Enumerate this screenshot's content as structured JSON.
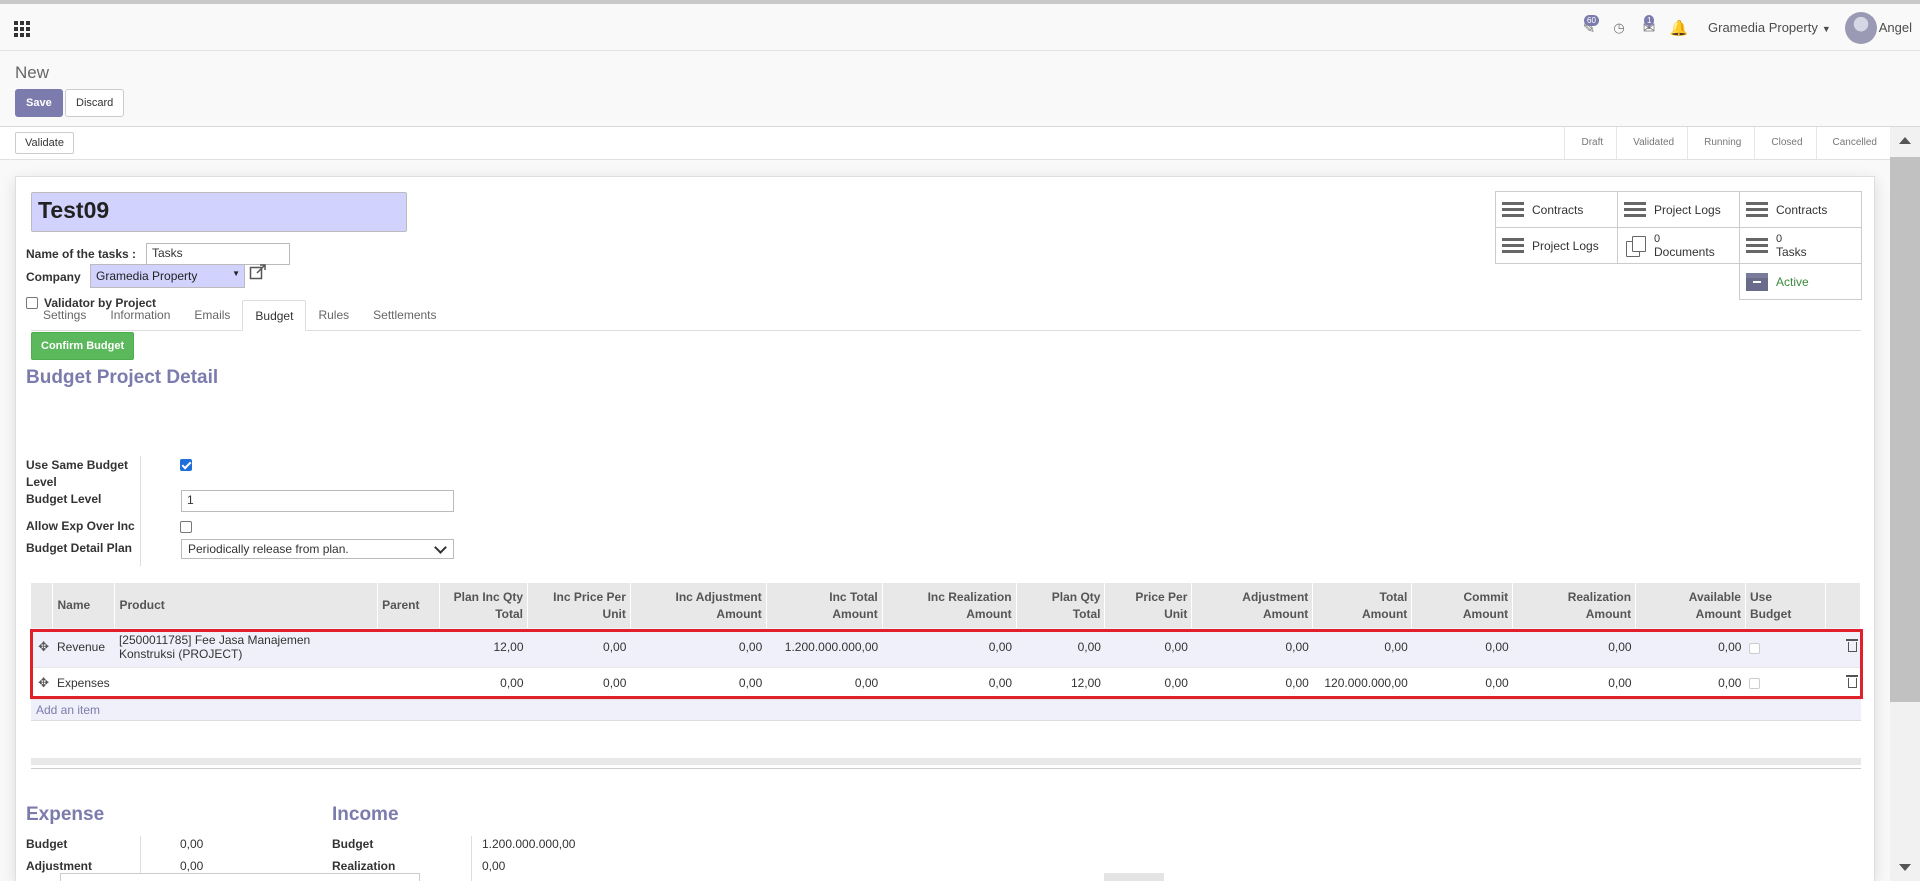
{
  "topbar": {
    "badges": {
      "activity": "60",
      "messages": "1"
    },
    "company": "Gramedia Property",
    "user": "Angel"
  },
  "control_panel": {
    "breadcrumb": "New",
    "save_label": "Save",
    "discard_label": "Discard"
  },
  "statusbar": {
    "validate_label": "Validate",
    "stages": [
      "Draft",
      "Validated",
      "Running",
      "Closed",
      "Cancelled"
    ]
  },
  "form": {
    "title": "Test09",
    "task_name_label": "Name of the tasks :",
    "task_name_value": "Tasks",
    "company_label": "Company",
    "company_value": "Gramedia Property",
    "validator_label": "Validator by Project"
  },
  "smart_buttons": {
    "contracts_1": "Contracts",
    "project_logs_1": "Project Logs",
    "contracts_2": "Contracts",
    "project_logs_2": "Project Logs",
    "documents_count": "0",
    "documents_label": "Documents",
    "tasks_count": "0",
    "tasks_label": "Tasks",
    "active_label": "Active"
  },
  "tabs": [
    "Settings",
    "Information",
    "Emails",
    "Budget",
    "Rules",
    "Settlements"
  ],
  "budget": {
    "confirm_label": "Confirm Budget",
    "section_title": "Budget Project Detail",
    "use_same_label_1": "Use Same Budget",
    "use_same_label_2": "Level",
    "level_label": "Budget Level",
    "level_value": "1",
    "allow_exp_label": "Allow Exp Over Inc",
    "detail_plan_label": "Budget Detail Plan",
    "detail_plan_value": "Periodically release from plan."
  },
  "table": {
    "headers": [
      [
        "Name"
      ],
      [
        "Product"
      ],
      [
        "Parent"
      ],
      [
        "Plan Inc Qty",
        "Total"
      ],
      [
        "Inc Price Per",
        "Unit"
      ],
      [
        "Inc Adjustment",
        "Amount"
      ],
      [
        "Inc Total",
        "Amount"
      ],
      [
        "Inc Realization",
        "Amount"
      ],
      [
        "Plan Qty",
        "Total"
      ],
      [
        "Price Per",
        "Unit"
      ],
      [
        "Adjustment",
        "Amount"
      ],
      [
        "Total",
        "Amount"
      ],
      [
        "Commit",
        "Amount"
      ],
      [
        "Realization",
        "Amount"
      ],
      [
        "Available",
        "Amount"
      ],
      [
        "Use",
        "Budget"
      ]
    ],
    "rows": [
      {
        "name": "Revenue",
        "product_1": "[2500011785] Fee Jasa Manajemen",
        "product_2": "Konstruksi (PROJECT)",
        "parent": "",
        "values": [
          "12,00",
          "0,00",
          "0,00",
          "1.200.000.000,00",
          "0,00",
          "0,00",
          "0,00",
          "0,00",
          "0,00",
          "0,00",
          "0,00",
          "0,00"
        ]
      },
      {
        "name": "Expenses",
        "product_1": "",
        "product_2": "",
        "parent": "",
        "values": [
          "0,00",
          "0,00",
          "0,00",
          "0,00",
          "0,00",
          "12,00",
          "0,00",
          "0,00",
          "120.000.000,00",
          "0,00",
          "0,00",
          "0,00"
        ]
      }
    ],
    "add_item_label": "Add an item"
  },
  "totals": {
    "expense_title": "Expense",
    "income_title": "Income",
    "expense_budget_label": "Budget",
    "expense_budget_value": "0,00",
    "expense_adjustment_label": "Adjustment",
    "expense_adjustment_value": "0,00",
    "income_budget_label": "Budget",
    "income_budget_value": "1.200.000.000,00",
    "income_realization_label": "Realization",
    "income_realization_value": "0,00"
  }
}
